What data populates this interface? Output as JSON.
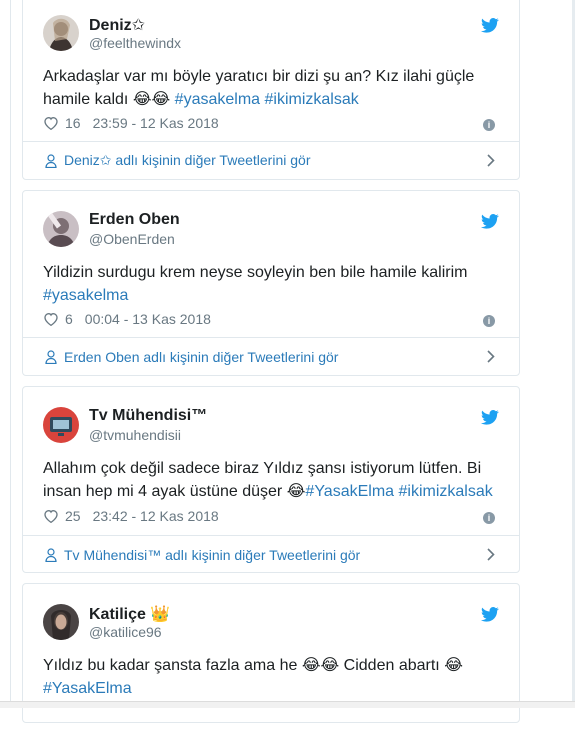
{
  "tweets": [
    {
      "name": "Deniz✩",
      "handle": "@feelthewindx",
      "text_line1": "Arkadaşlar var mı böyle yaratıcı bir dizi şu an? Kız ilahi güçle",
      "text_line2": "hamile kaldı",
      "emoji": "😂😂",
      "hashtags": [
        "#yasakelma",
        "#ikimizkalsak"
      ],
      "likes": "16",
      "timestamp": "23:59 - 12 Kas 2018",
      "footer": "Deniz✩ adlı kişinin diğer Tweetlerini gör",
      "avatar_color": "#c7bdb5"
    },
    {
      "name": "Erden Oben",
      "handle": "@ObenErden",
      "text_line1": "Yildizin surdugu krem neyse soyleyin ben bile hamile kalirim",
      "hashtags": [
        "#yasakelma"
      ],
      "likes": "6",
      "timestamp": "00:04 - 13 Kas 2018",
      "footer": "Erden Oben adlı kişinin diğer Tweetlerini gör",
      "avatar_color": "#8a7f86"
    },
    {
      "name": "Tv Mühendisi™",
      "handle": "@tvmuhendisii",
      "text_line1": "Allahım çok değil sadece biraz Yıldız şansı istiyorum lütfen. Bi",
      "text_line2": "insan hep mi 4 ayak üstüne düşer",
      "emoji": "😂",
      "hashtags": [
        "#YasakElma",
        "#ikimizkalsak"
      ],
      "likes": "25",
      "timestamp": "23:42 - 12 Kas 2018",
      "footer": "Tv Mühendisi™ adlı kişinin diğer Tweetlerini gör",
      "avatar_color": "#d9443c"
    },
    {
      "name": "Katiliçe",
      "name_emoji": "👑",
      "handle": "@katilice96",
      "text_part1": "Yıldız bu kadar şansta fazla ama he",
      "emoji1": "😂😂",
      "text_part2": "Cidden abartı",
      "emoji2": "😂",
      "hashtags": [
        "#YasakElma"
      ],
      "avatar_color": "#3f3a3a"
    }
  ]
}
